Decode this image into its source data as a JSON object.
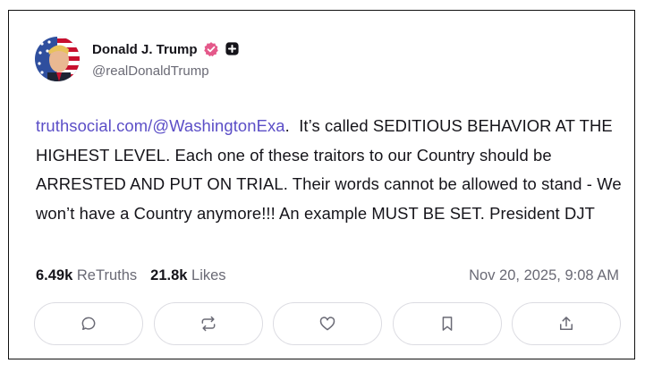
{
  "post": {
    "author": {
      "display_name": "Donald J. Trump",
      "handle": "@realDonaldTrump",
      "verified_badge_color": "#e4598a",
      "badge_icon": "verified-badge-icon",
      "plus_icon": "plus-badge-icon"
    },
    "body": {
      "link_text": "truthsocial.com/@WashingtonExa",
      "link_suffix": ".",
      "text": "It’s called SEDITIOUS BEHAVIOR AT THE HIGHEST LEVEL. Each one of these traitors to our Country should be ARRESTED AND PUT ON TRIAL. Their words cannot be allowed to stand - We won’t have a Country anymore!!! An example MUST BE SET. President DJT"
    },
    "stats": {
      "retruths_count": "6.49k",
      "retruths_label": "ReTruths",
      "likes_count": "21.8k",
      "likes_label": "Likes",
      "timestamp": "Nov 20, 2025, 9:08 AM"
    },
    "actions": [
      {
        "name": "reply",
        "icon": "comment-bubble-icon"
      },
      {
        "name": "retruth",
        "icon": "repost-arrows-icon"
      },
      {
        "name": "like",
        "icon": "heart-icon"
      },
      {
        "name": "bookmark",
        "icon": "bookmark-icon"
      },
      {
        "name": "share",
        "icon": "share-upload-icon"
      }
    ],
    "colors": {
      "link": "#5b4ec7",
      "text": "#15141a",
      "muted": "#6a6a75",
      "button_border": "#dcdce2"
    }
  }
}
